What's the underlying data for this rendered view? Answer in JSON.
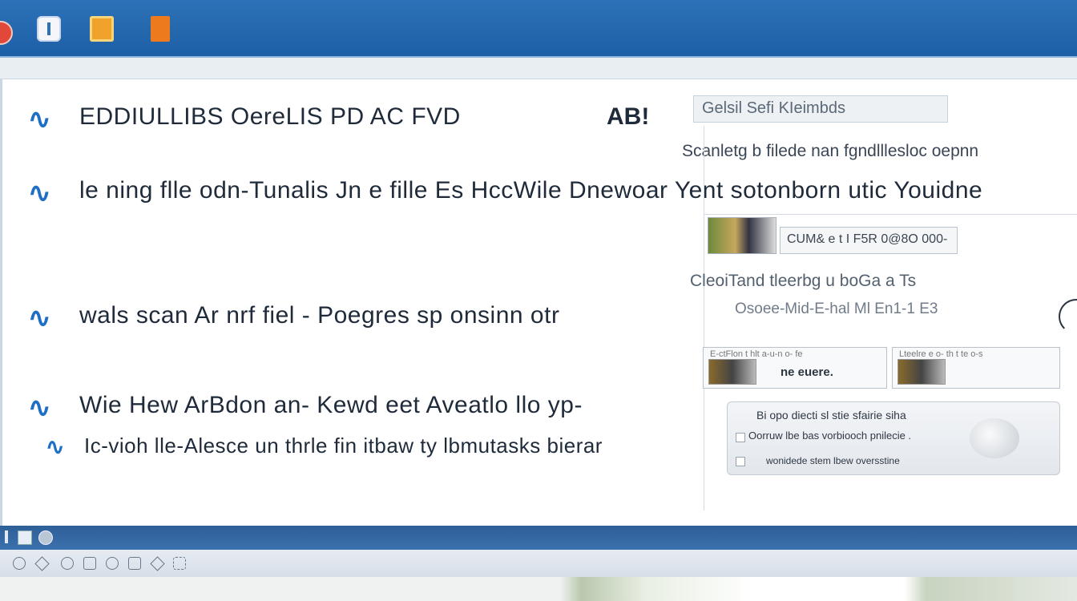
{
  "window": {
    "toolbar_icons": [
      "app-red-icon",
      "info-icon",
      "folder-icon",
      "document-icon"
    ]
  },
  "main": {
    "rows": [
      {
        "text": "EDDIULLIBS OereLIS  PD AC  FVD",
        "extra": "AB!"
      },
      {
        "text": "le ning flle odn-Tunalis Jn e fille Es  HccWile Dnewoar Yent sotonborn utic   Youidne"
      },
      {
        "text": "wals scan  Ar nrf fiel -  Poegres sp onsinn otr"
      },
      {
        "text": "Wie  Hew  ArBdon an- Kewd eet Aveatlo llo yp-"
      },
      {
        "text": "Ic-vioh lle-Alesce  un thrle fin itbaw  ty lbmutasks bierar"
      }
    ]
  },
  "side": {
    "search_text": "Gelsil  Sefi KIeimbds",
    "heading": "Scanletg b filede nan fgndlllesloc oepnn",
    "chip_a": "CUM& e t I F5R 0@8O 000-",
    "sub1": "CleoiTand tleerbg u boGa a Ts",
    "sub2": "Osoee-Mid-E-hal Ml En1-1 E3",
    "card_a": {
      "caption": "E-ctFlon t hlt a-u-n o- fe",
      "label": "ne euere."
    },
    "card_b": {
      "caption": "Lteelre e o- th t te o-s"
    },
    "dialog": {
      "line1": "Bi opo diecti sl stie sfairie siha",
      "line2": "Oorruw lbe bas vorbiooch pnilecie .",
      "line3": "wonidede stem lbew oversstine"
    }
  }
}
